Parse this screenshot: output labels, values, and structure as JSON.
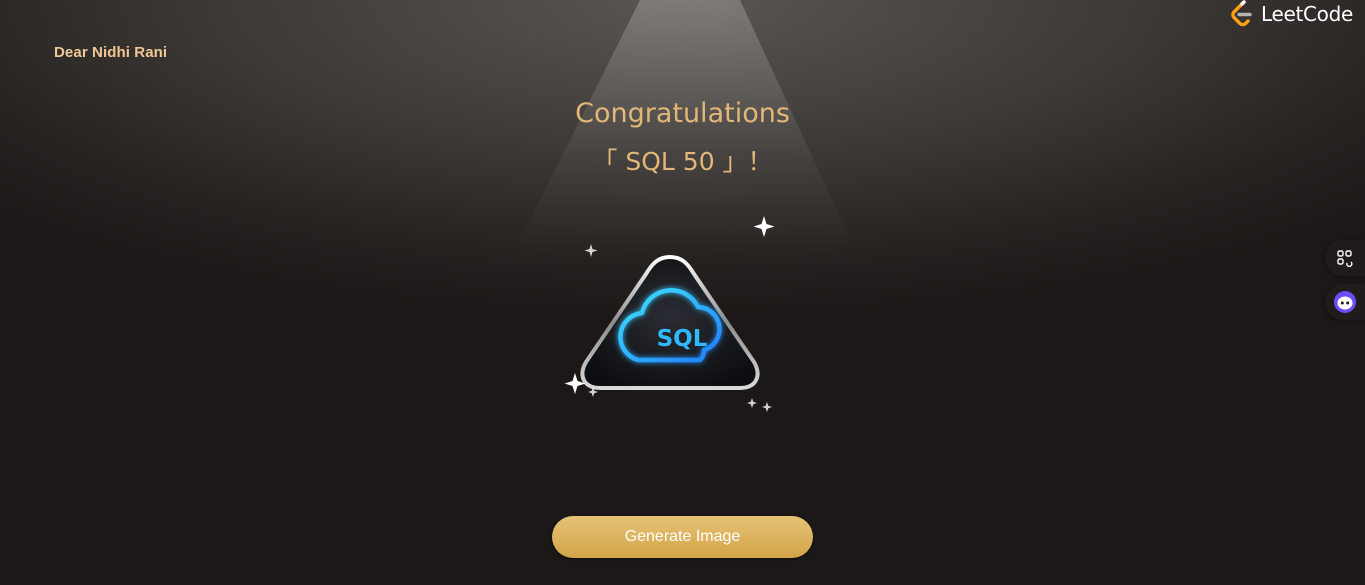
{
  "header": {
    "greeting": "Dear Nidhi Rani",
    "brand": "LeetCode"
  },
  "main": {
    "title_line1": "Congratulations",
    "title_line2": "「 SQL 50 」！",
    "badge_text": "SQL",
    "generate_button": "Generate Image"
  },
  "colors": {
    "accent_gold": "#e2b778",
    "badge_glow": "#22b8f0",
    "logo_orange": "#ffa116"
  },
  "side_tools": [
    {
      "icon": "apps-grid-icon"
    },
    {
      "icon": "assistant-bot-icon"
    }
  ]
}
